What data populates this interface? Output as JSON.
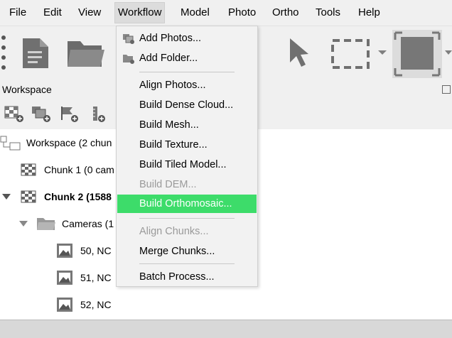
{
  "menubar": {
    "file": "File",
    "edit": "Edit",
    "view": "View",
    "workflow": "Workflow",
    "model": "Model",
    "photo": "Photo",
    "ortho": "Ortho",
    "tools": "Tools",
    "help": "Help"
  },
  "workspace": {
    "title": "Workspace",
    "tree": {
      "root": "Workspace (2 chun",
      "chunk1": "Chunk 1 (0 cam",
      "chunk2": "Chunk 2 (1588",
      "cameras": "Cameras (1",
      "cam50": "50, NC",
      "cam51": "51, NC",
      "cam52": "52, NC"
    }
  },
  "workflow_menu": {
    "add_photos": "Add Photos...",
    "add_folder": "Add Folder...",
    "align_photos": "Align Photos...",
    "build_dense_cloud": "Build Dense Cloud...",
    "build_mesh": "Build Mesh...",
    "build_texture": "Build Texture...",
    "build_tiled_model": "Build Tiled Model...",
    "build_dem": "Build DEM...",
    "build_orthomosaic": "Build Orthomosaic...",
    "align_chunks": "Align Chunks...",
    "merge_chunks": "Merge Chunks...",
    "batch_process": "Batch Process..."
  },
  "colors": {
    "highlight": "#3ddc6a",
    "disabled_text": "#9a9a9a",
    "menubar_bg": "#f0f0f0"
  }
}
